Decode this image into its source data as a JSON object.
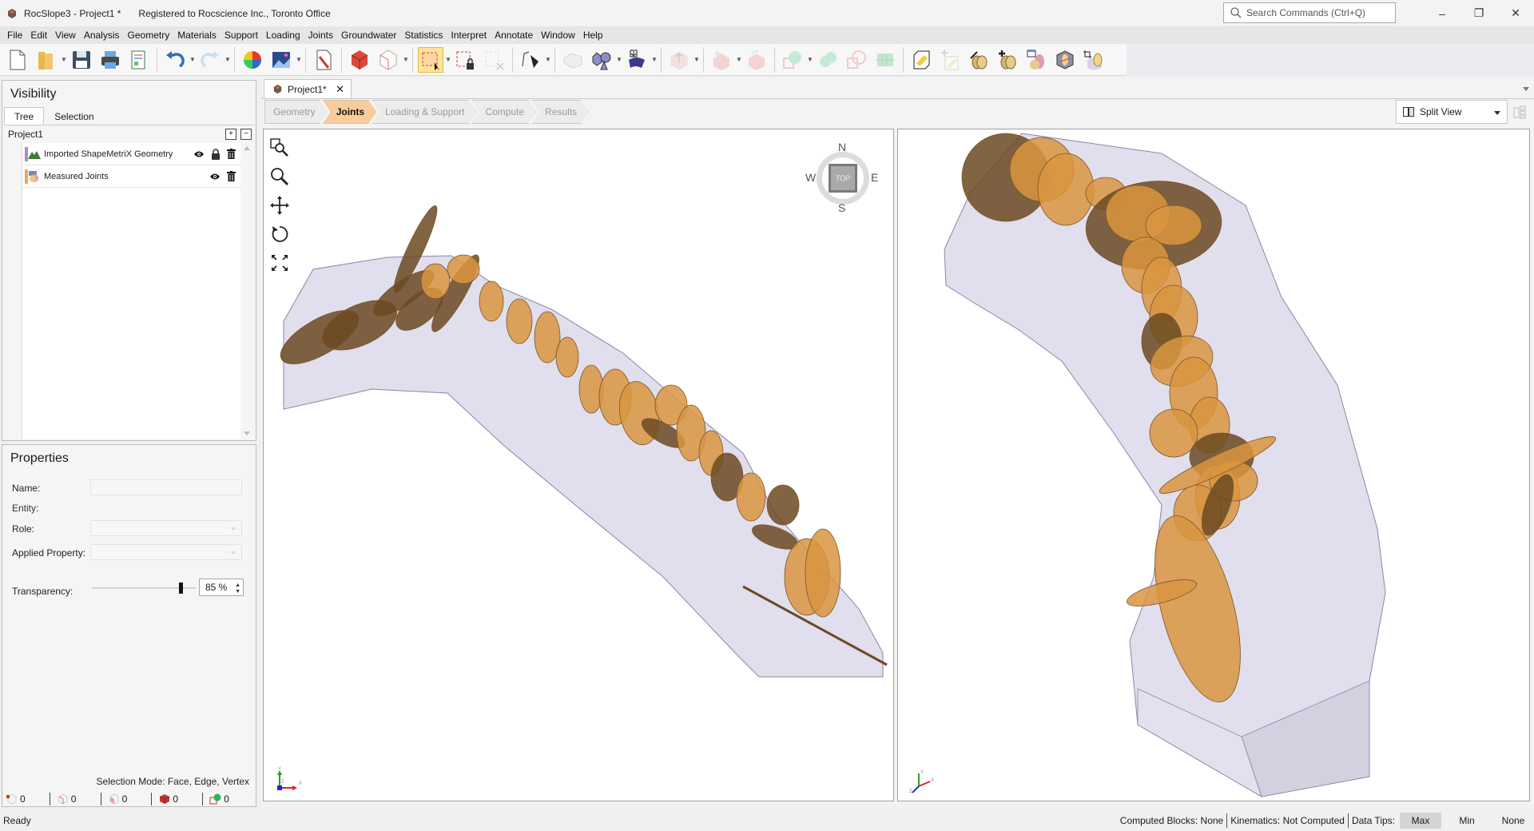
{
  "window": {
    "title": "RocSlope3 - Project1 *",
    "registration": "Registered to Rocscience Inc., Toronto Office",
    "search_placeholder": "Search Commands (Ctrl+Q)",
    "controls": {
      "minimize": "–",
      "restore": "❐",
      "close": "✕"
    }
  },
  "menu": [
    "File",
    "Edit",
    "View",
    "Analysis",
    "Geometry",
    "Materials",
    "Support",
    "Loading",
    "Joints",
    "Groundwater",
    "Statistics",
    "Interpret",
    "Annotate",
    "Window",
    "Help"
  ],
  "toolbar": {
    "buttons": [
      {
        "name": "new-file-icon",
        "enabled": true
      },
      {
        "name": "open-folder-icon",
        "enabled": true,
        "dropdown": true
      },
      {
        "name": "save-icon",
        "enabled": true
      },
      {
        "name": "print-icon",
        "enabled": true
      },
      {
        "name": "report-icon",
        "enabled": true
      },
      {
        "name": "undo-icon",
        "enabled": true,
        "dropdown": true
      },
      {
        "name": "redo-icon",
        "enabled": false,
        "dropdown": true
      },
      {
        "name": "color-wheel-icon",
        "enabled": true
      },
      {
        "name": "background-image-icon",
        "enabled": true,
        "dropdown": true
      },
      {
        "name": "edit-document-icon",
        "enabled": true
      },
      {
        "name": "solid-block-icon",
        "enabled": true
      },
      {
        "name": "wireframe-block-icon",
        "enabled": true,
        "dropdown": true
      },
      {
        "name": "select-box-icon",
        "enabled": true,
        "active": true,
        "dropdown": true
      },
      {
        "name": "lock-selection-icon",
        "enabled": true
      },
      {
        "name": "clear-selection-icon",
        "enabled": false
      },
      {
        "name": "polyline-pen-icon",
        "enabled": true,
        "dropdown": true
      },
      {
        "name": "surface-icon",
        "enabled": false
      },
      {
        "name": "shapes-icon",
        "enabled": true,
        "dropdown": true
      },
      {
        "name": "import-surface-icon",
        "enabled": true,
        "dropdown": true
      },
      {
        "name": "extrude-icon",
        "enabled": false,
        "dropdown": true
      },
      {
        "name": "move-block-icon",
        "enabled": false,
        "dropdown": true
      },
      {
        "name": "rotate-block-icon",
        "enabled": false
      },
      {
        "name": "boolean-union-icon",
        "enabled": false,
        "dropdown": true
      },
      {
        "name": "boolean-intersect-icon",
        "enabled": false
      },
      {
        "name": "boolean-subtract-icon",
        "enabled": false
      },
      {
        "name": "section-grid-icon",
        "enabled": false
      },
      {
        "name": "edit-joint-box-icon",
        "enabled": true
      },
      {
        "name": "add-joint-box-icon",
        "enabled": false
      },
      {
        "name": "edit-joint-set-icon",
        "enabled": true
      },
      {
        "name": "add-joint-set-icon",
        "enabled": true
      },
      {
        "name": "joint-table-icon",
        "enabled": true
      },
      {
        "name": "joint-on-face-icon",
        "enabled": true
      },
      {
        "name": "crop-joints-icon",
        "enabled": true
      }
    ]
  },
  "visibility": {
    "title": "Visibility",
    "tabs": [
      "Tree",
      "Selection"
    ],
    "active_tab": "Tree",
    "root": "Project1",
    "items": [
      {
        "label": "Imported ShapeMetriX Geometry",
        "color": "#a98fc9",
        "visible": true,
        "locked": true
      },
      {
        "label": "Measured Joints",
        "color": "#f4a94a",
        "visible": true,
        "locked": false
      }
    ]
  },
  "properties": {
    "title": "Properties",
    "name_label": "Name:",
    "name_value": "",
    "entity_label": "Entity:",
    "role_label": "Role:",
    "role_value": "",
    "applied_label": "Applied Property:",
    "applied_value": "",
    "transparency_label": "Transparency:",
    "transparency_value": "85 %",
    "transparency_fraction": 0.85,
    "selection_mode": "Selection Mode: Face, Edge, Vertex",
    "counts": [
      {
        "icon": "vertex-count-icon",
        "value": "0"
      },
      {
        "icon": "edge-count-icon",
        "value": "0"
      },
      {
        "icon": "face-count-icon",
        "value": "0"
      },
      {
        "icon": "block-count-icon",
        "value": "0"
      },
      {
        "icon": "joint-count-icon",
        "value": "0"
      }
    ]
  },
  "document": {
    "tab_label": "Project1*",
    "workflow": [
      "Geometry",
      "Joints",
      "Loading & Support",
      "Compute",
      "Results"
    ],
    "active_step": "Joints",
    "view_mode": "Split View"
  },
  "viewport_left": {
    "compass": {
      "n": "N",
      "s": "S",
      "e": "E",
      "w": "W",
      "face": "TOP"
    },
    "axes": {
      "x": "X",
      "y": "Y",
      "z": "Z"
    }
  },
  "viewport_right": {
    "axes": {
      "x": "X",
      "y": "Y",
      "z": "Z"
    }
  },
  "status": {
    "ready": "Ready",
    "computed_blocks_label": "Computed Blocks:",
    "computed_blocks_value": "None",
    "kinematics_label": "Kinematics:",
    "kinematics_value": "Not Computed",
    "data_tips_label": "Data Tips:",
    "data_tips_options": [
      "Max",
      "Min",
      "None"
    ],
    "data_tips_active": "Max"
  },
  "colors": {
    "joint_light": "#d9953f",
    "joint_dark": "#6b4a22",
    "slope_fill": "#dcd8ea",
    "slope_edge": "#8a86a8",
    "workflow_active": "#f9cc99"
  }
}
